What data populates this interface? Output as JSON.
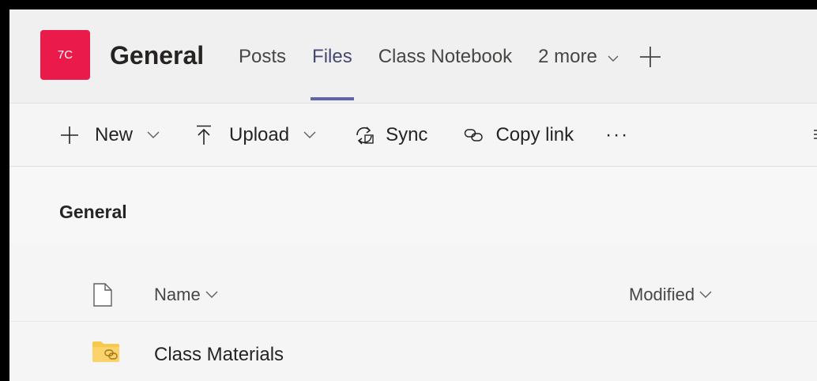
{
  "header": {
    "team_avatar": "7C",
    "channel_title": "General",
    "tabs": [
      {
        "label": "Posts",
        "active": false
      },
      {
        "label": "Files",
        "active": true
      },
      {
        "label": "Class Notebook",
        "active": false
      },
      {
        "label": "2 more",
        "active": false
      }
    ],
    "add_tab_icon": "plus-icon"
  },
  "toolbar": {
    "new_label": "New",
    "upload_label": "Upload",
    "sync_label": "Sync",
    "copy_link_label": "Copy link",
    "more_label": "···"
  },
  "breadcrumb": {
    "current": "General"
  },
  "file_list": {
    "columns": {
      "name": "Name",
      "modified": "Modified"
    },
    "rows": [
      {
        "name": "Class Materials",
        "type": "folder"
      }
    ]
  },
  "colors": {
    "team_avatar": "#ea1a4b",
    "active_tab_underline": "#6264a7",
    "folder": "#fcd26b"
  }
}
